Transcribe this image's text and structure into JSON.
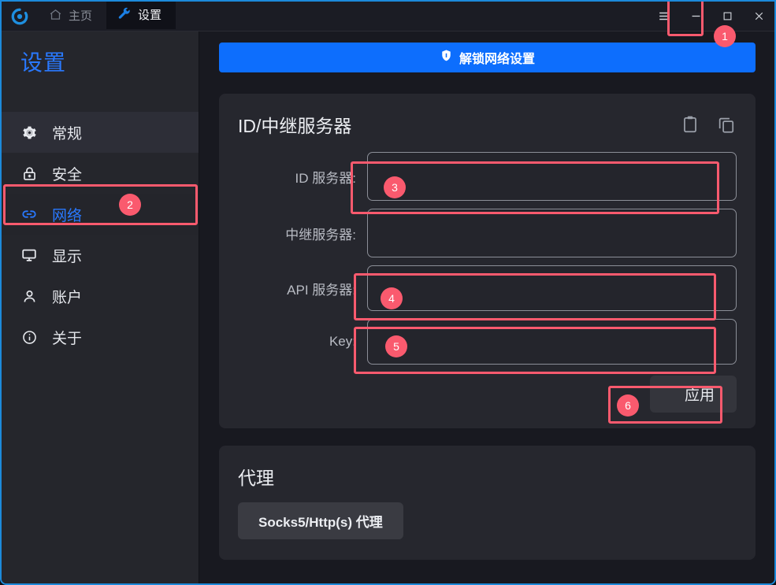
{
  "window": {
    "accent_blue": "#0d6efd",
    "badge_color": "#fa5a6e",
    "border_color": "#1c8adb"
  },
  "titlebar": {
    "logo_name": "rustdesk-logo",
    "tabs": [
      {
        "label": "主页",
        "icon": "home-icon",
        "active": false
      },
      {
        "label": "设置",
        "icon": "wrench-icon",
        "active": true
      }
    ],
    "controls": {
      "menu": "☰",
      "minimize": "—",
      "maximize": "☐",
      "close": "✕"
    }
  },
  "sidebar": {
    "title": "设置",
    "items": [
      {
        "label": "常规",
        "icon": "gear-icon"
      },
      {
        "label": "安全",
        "icon": "lock-icon"
      },
      {
        "label": "网络",
        "icon": "link-icon"
      },
      {
        "label": "显示",
        "icon": "monitor-icon"
      },
      {
        "label": "账户",
        "icon": "person-icon"
      },
      {
        "label": "关于",
        "icon": "info-icon"
      }
    ],
    "selected_index": 2,
    "hovered_index": 0
  },
  "main": {
    "unlock_button": {
      "label": "解锁网络设置",
      "icon": "shield-icon"
    },
    "server_card": {
      "title": "ID/中继服务器",
      "actions": [
        {
          "icon": "clipboard-paste-icon",
          "name": "paste-button"
        },
        {
          "icon": "copy-icon",
          "name": "copy-button"
        }
      ],
      "fields": [
        {
          "label": "ID 服务器:",
          "value": "",
          "name": "id-server-input"
        },
        {
          "label": "中继服务器:",
          "value": "",
          "name": "relay-server-input"
        },
        {
          "label": "API 服务器:",
          "value": "",
          "name": "api-server-input"
        },
        {
          "label": "Key:",
          "value": "",
          "name": "key-input"
        }
      ],
      "apply_label": "应用"
    },
    "proxy_card": {
      "title": "代理",
      "button_label": "Socks5/Http(s) 代理"
    }
  },
  "annotations": [
    {
      "number": "1",
      "target": "hamburger-menu-button"
    },
    {
      "number": "2",
      "target": "sidebar-item-network"
    },
    {
      "number": "3",
      "target": "id-server-input"
    },
    {
      "number": "4",
      "target": "api-server-input"
    },
    {
      "number": "5",
      "target": "key-input"
    },
    {
      "number": "6",
      "target": "apply-button"
    }
  ]
}
